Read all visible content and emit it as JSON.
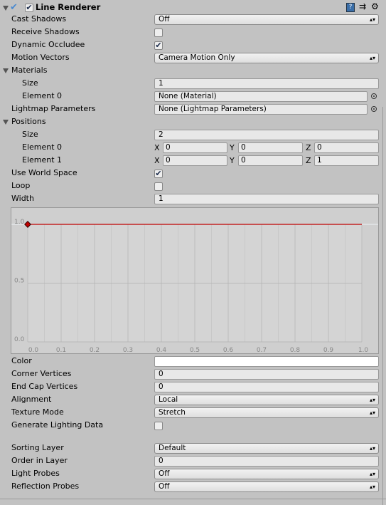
{
  "component": {
    "title": "Line Renderer",
    "enabled": true,
    "icons": [
      "help-icon",
      "preset-icon",
      "gear-icon"
    ]
  },
  "rows": {
    "cast_shadows": {
      "label": "Cast Shadows",
      "value": "Off"
    },
    "receive_shadows": {
      "label": "Receive Shadows",
      "checked": false
    },
    "dynamic_occludee": {
      "label": "Dynamic Occludee",
      "checked": true
    },
    "motion_vectors": {
      "label": "Motion Vectors",
      "value": "Camera Motion Only"
    },
    "materials": {
      "label": "Materials",
      "size_label": "Size",
      "size": "1",
      "element0_label": "Element 0",
      "element0": "None (Material)"
    },
    "lightmap": {
      "label": "Lightmap Parameters",
      "value": "None (Lightmap Parameters)"
    },
    "positions": {
      "label": "Positions",
      "size_label": "Size",
      "size": "2",
      "elements": [
        {
          "label": "Element 0",
          "x": "0",
          "y": "0",
          "z": "0"
        },
        {
          "label": "Element 1",
          "x": "0",
          "y": "0",
          "z": "1"
        }
      ]
    },
    "axis_labels": {
      "x": "X",
      "y": "Y",
      "z": "Z"
    },
    "use_world_space": {
      "label": "Use World Space",
      "checked": true
    },
    "loop": {
      "label": "Loop",
      "checked": false
    },
    "width": {
      "label": "Width",
      "value": "1"
    },
    "color": {
      "label": "Color",
      "value": "#ffffff"
    },
    "corner_vertices": {
      "label": "Corner Vertices",
      "value": "0"
    },
    "end_cap_vertices": {
      "label": "End Cap Vertices",
      "value": "0"
    },
    "alignment": {
      "label": "Alignment",
      "value": "Local"
    },
    "texture_mode": {
      "label": "Texture Mode",
      "value": "Stretch"
    },
    "generate_lighting": {
      "label": "Generate Lighting Data",
      "checked": false
    },
    "sorting_layer": {
      "label": "Sorting Layer",
      "value": "Default"
    },
    "order_in_layer": {
      "label": "Order in Layer",
      "value": "0"
    },
    "light_probes": {
      "label": "Light Probes",
      "value": "Off"
    },
    "reflection_probes": {
      "label": "Reflection Probes",
      "value": "Off"
    }
  },
  "chart_data": {
    "type": "line",
    "x_ticks": [
      "0.0",
      "0.1",
      "0.2",
      "0.3",
      "0.4",
      "0.5",
      "0.6",
      "0.7",
      "0.8",
      "0.9",
      "1.0"
    ],
    "y_ticks": [
      "0.0",
      "0.5",
      "1.0"
    ],
    "xlim": [
      0,
      1
    ],
    "ylim": [
      0,
      1
    ],
    "points": [
      {
        "x": 0,
        "y": 1
      },
      {
        "x": 1,
        "y": 1
      }
    ],
    "keys": [
      {
        "x": 0,
        "y": 1
      }
    ],
    "line_color": "#c00000",
    "grid": true
  }
}
